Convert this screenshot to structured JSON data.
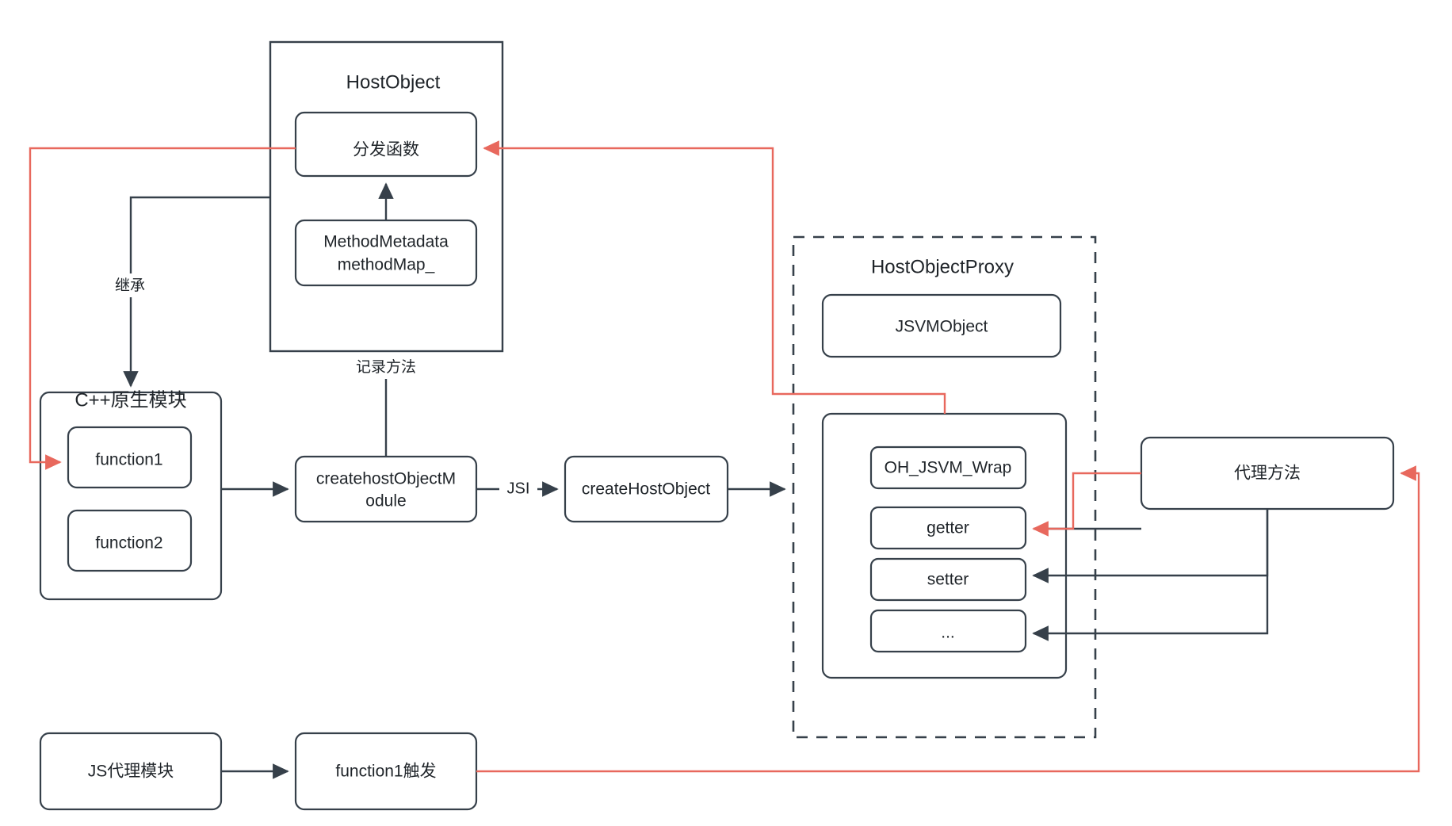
{
  "diagram": {
    "title": "HostObject / HostObjectProxy architecture flow",
    "colors": {
      "stroke": "#36404a",
      "red_edge": "#e8685d",
      "text": "#1f2429",
      "background": "#ffffff"
    },
    "groups": {
      "host_object": {
        "label": "HostObject"
      },
      "cpp_native_module": {
        "label": "C++原生模块"
      },
      "host_object_proxy": {
        "label": "HostObjectProxy"
      }
    },
    "nodes": {
      "dispatch_fn": {
        "label": "分发函数"
      },
      "method_metadata": {
        "label": "MethodMetadata\nmethodMap_",
        "line1": "MethodMetadata",
        "line2": "methodMap_"
      },
      "function1": {
        "label": "function1"
      },
      "function2": {
        "label": "function2"
      },
      "create_host_object_module": {
        "label": "createhostObjectM\nodule",
        "line1": "createhostObjectM",
        "line2": "odule"
      },
      "create_host_object": {
        "label": "createHostObject"
      },
      "jsvm_object": {
        "label": "JSVMObject"
      },
      "oh_jsvm_wrap": {
        "label": "OH_JSVM_Wrap"
      },
      "getter": {
        "label": "getter"
      },
      "setter": {
        "label": "setter"
      },
      "ellipsis": {
        "label": "..."
      },
      "proxy_method": {
        "label": "代理方法"
      },
      "js_proxy_module": {
        "label": "JS代理模块"
      },
      "function1_trigger": {
        "label": "function1触发"
      }
    },
    "edge_labels": {
      "inherit": "继承",
      "record_method": "记录方法",
      "jsi": "JSI"
    }
  }
}
